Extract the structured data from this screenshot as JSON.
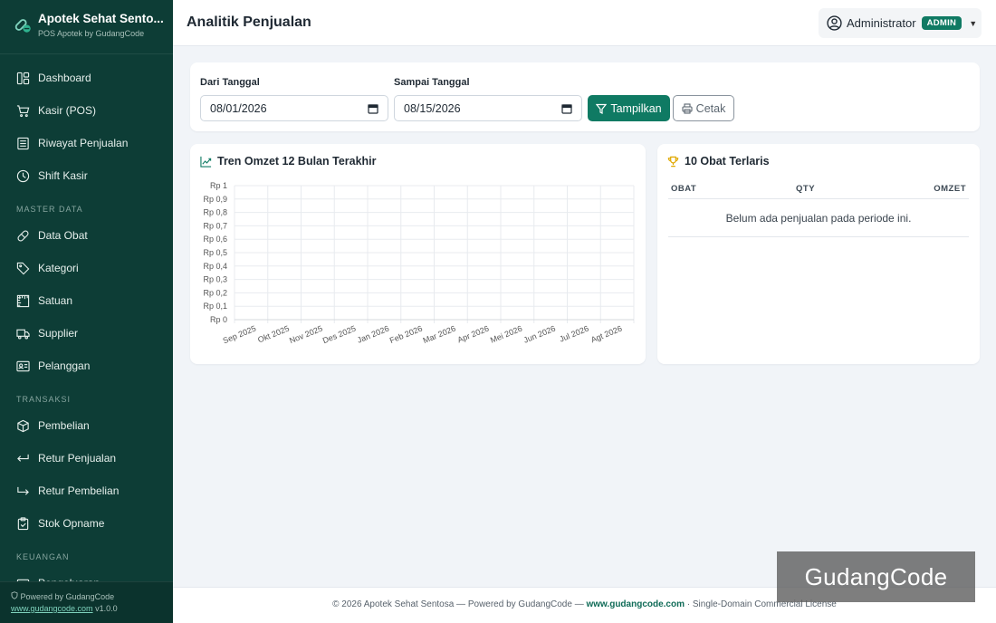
{
  "brand": {
    "title": "Apotek Sehat Sento...",
    "subtitle": "POS Apotek by GudangCode"
  },
  "sidebar": {
    "items": [
      {
        "label": "Dashboard",
        "icon": "dashboard-icon"
      },
      {
        "label": "Kasir (POS)",
        "icon": "cart-icon"
      },
      {
        "label": "Riwayat Penjualan",
        "icon": "receipt-icon"
      },
      {
        "label": "Shift Kasir",
        "icon": "clock-icon"
      }
    ],
    "master_title": "MASTER DATA",
    "master_items": [
      {
        "label": "Data Obat",
        "icon": "capsule-icon"
      },
      {
        "label": "Kategori",
        "icon": "tag-icon"
      },
      {
        "label": "Satuan",
        "icon": "ruler-icon"
      },
      {
        "label": "Supplier",
        "icon": "truck-icon"
      },
      {
        "label": "Pelanggan",
        "icon": "person-card-icon"
      }
    ],
    "trans_title": "TRANSAKSI",
    "trans_items": [
      {
        "label": "Pembelian",
        "icon": "box-icon"
      },
      {
        "label": "Retur Penjualan",
        "icon": "return-left-icon"
      },
      {
        "label": "Retur Pembelian",
        "icon": "return-right-icon"
      },
      {
        "label": "Stok Opname",
        "icon": "clipboard-check-icon"
      }
    ],
    "finance_title": "KEUANGAN",
    "finance_items": [
      {
        "label": "Pengeluaran",
        "icon": "wallet-icon"
      }
    ],
    "footer_powered": "Powered by GudangCode",
    "footer_link": "www.gudangcode.com",
    "footer_version": "v1.0.0"
  },
  "header": {
    "title": "Analitik Penjualan",
    "user": "Administrator",
    "role": "ADMIN"
  },
  "filter": {
    "from_label": "Dari Tanggal",
    "from_value": "08/01/2026",
    "to_label": "Sampai Tanggal",
    "to_value": "08/15/2026",
    "submit_label": "Tampilkan",
    "print_label": "Cetak"
  },
  "chart_card": {
    "title": "Tren Omzet 12 Bulan Terakhir"
  },
  "chart_data": {
    "type": "line",
    "x": [
      "Sep 2025",
      "Okt 2025",
      "Nov 2025",
      "Des 2025",
      "Jan 2026",
      "Feb 2026",
      "Mar 2026",
      "Apr 2026",
      "Mei 2026",
      "Jun 2026",
      "Jul 2026",
      "Agt 2026"
    ],
    "y_ticks": [
      "Rp 0",
      "Rp 0,1",
      "Rp 0,2",
      "Rp 0,3",
      "Rp 0,4",
      "Rp 0,5",
      "Rp 0,6",
      "Rp 0,7",
      "Rp 0,8",
      "Rp 0,9",
      "Rp 1"
    ],
    "ylim": [
      0,
      1
    ],
    "series": [],
    "grid": true
  },
  "top_card": {
    "title": "10 Obat Terlaris",
    "col_obat": "OBAT",
    "col_qty": "QTY",
    "col_omzet": "OMZET",
    "empty": "Belum ada penjualan pada periode ini."
  },
  "footer": {
    "text_before": "© 2026 Apotek Sehat Sentosa — Powered by GudangCode — ",
    "link": "www.gudangcode.com",
    "text_after": " · Single-Domain Commercial License"
  },
  "watermark": "GudangCode",
  "colors": {
    "sidebar": "#0d3d36",
    "accent": "#0f7a63"
  }
}
